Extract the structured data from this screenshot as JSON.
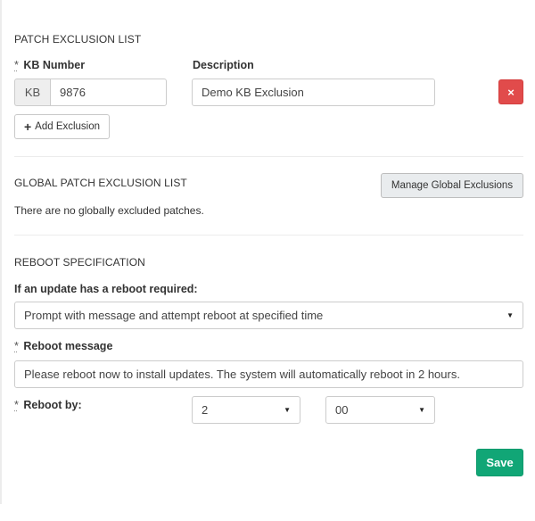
{
  "patch_exclusion": {
    "title": "PATCH EXCLUSION LIST",
    "kb_label": "KB Number",
    "required_marker": "*",
    "description_label": "Description",
    "kb_prefix": "KB",
    "kb_value": "9876",
    "description_value": "Demo KB Exclusion",
    "remove_icon": "×",
    "add_button_icon": "+",
    "add_button_label": "Add Exclusion"
  },
  "global_exclusion": {
    "title": "GLOBAL PATCH EXCLUSION LIST",
    "manage_button_label": "Manage Global Exclusions",
    "empty_text": "There are no globally excluded patches."
  },
  "reboot": {
    "title": "REBOOT SPECIFICATION",
    "policy_label": "If an update has a reboot required:",
    "policy_value": "Prompt with message and attempt reboot at specified time",
    "message_label": "Reboot message",
    "message_value": "Please reboot now to install updates. The system will automatically reboot in 2 hours.",
    "reboot_by_label": "Reboot by:",
    "hour_value": "2",
    "minute_value": "00",
    "caret": "▼"
  },
  "actions": {
    "save_label": "Save"
  },
  "colors": {
    "danger": "#e14b4b",
    "success": "#11a676"
  }
}
